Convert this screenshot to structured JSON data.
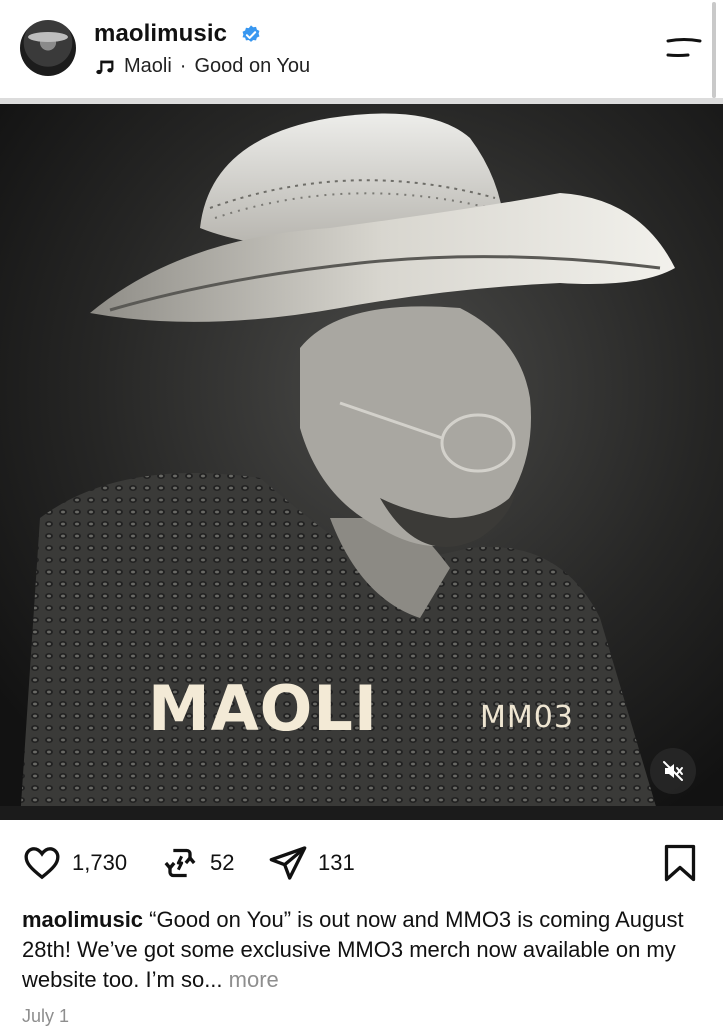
{
  "post": {
    "username": "maolimusic",
    "verified": true,
    "audio_artist": "Maoli",
    "audio_separator": "·",
    "audio_title": "Good on You",
    "date": "July 1"
  },
  "media": {
    "title_text": "MAOLI",
    "subtitle_text": "MM03",
    "muted": true
  },
  "stats": {
    "likes": "1,730",
    "reposts": "52",
    "shares": "131"
  },
  "caption": {
    "username": "maolimusic",
    "text": "“Good on You” is out now and MMO3 is coming August 28th! We’ve got some exclusive MMO3 merch now available on my website too. I’m so...",
    "more": "more"
  },
  "colors": {
    "verified_blue": "#3897f0",
    "muted_text": "#8e8e8e",
    "title_cream": "#f3ead6"
  },
  "icons": [
    "verified-icon",
    "music-note-icon",
    "menu-icon",
    "mute-icon",
    "heart-icon",
    "repost-icon",
    "share-icon",
    "bookmark-icon"
  ]
}
